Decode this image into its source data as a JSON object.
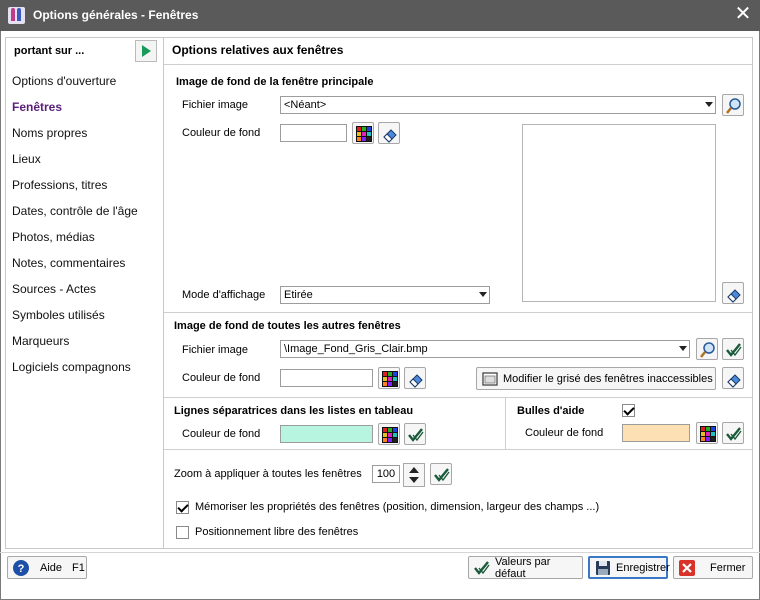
{
  "window": {
    "title": "Options générales - Fenêtres"
  },
  "nav": {
    "header": "portant sur ...",
    "items": [
      {
        "label": "Options d'ouverture",
        "active": false
      },
      {
        "label": "Fenêtres",
        "active": true
      },
      {
        "label": "Noms propres",
        "active": false
      },
      {
        "label": "Lieux",
        "active": false
      },
      {
        "label": "Professions, titres",
        "active": false
      },
      {
        "label": "Dates, contrôle de l'âge",
        "active": false
      },
      {
        "label": "Photos, médias",
        "active": false
      },
      {
        "label": "Notes, commentaires",
        "active": false
      },
      {
        "label": "Sources - Actes",
        "active": false
      },
      {
        "label": "Symboles utilisés",
        "active": false
      },
      {
        "label": "Marqueurs",
        "active": false
      },
      {
        "label": "Logiciels compagnons",
        "active": false
      }
    ]
  },
  "panel": {
    "title": "Options relatives aux fenêtres"
  },
  "main_bg": {
    "title": "Image de fond de la fenêtre principale",
    "file_label": "Fichier image",
    "file_value": "<Néant>",
    "color_label": "Couleur de fond",
    "color_value": "#ffffff",
    "mode_label": "Mode d'affichage",
    "mode_value": "Etirée"
  },
  "other_bg": {
    "title": "Image de fond de toutes les autres fenêtres",
    "file_label": "Fichier image",
    "file_value": "\\Image_Fond_Gris_Clair.bmp",
    "color_label": "Couleur de fond",
    "color_value": "#ffffff",
    "grey_button": "Modifier le grisé des fenêtres inaccessibles"
  },
  "separators": {
    "title": "Lignes séparatrices dans les listes en tableau",
    "color_label": "Couleur de fond",
    "color_value": "#b8f5e0"
  },
  "tooltips": {
    "title": "Bulles d'aide",
    "checked": true,
    "color_label": "Couleur de fond",
    "color_value": "#fde0b4"
  },
  "zoom": {
    "label": "Zoom à appliquer à toutes les fenêtres",
    "value": "100"
  },
  "options": {
    "remember_label": "Mémoriser les propriétés des fenêtres (position, dimension, largeur des champs ...)",
    "remember_checked": true,
    "free_label": "Positionnement libre des fenêtres",
    "free_checked": false
  },
  "footer": {
    "help_label": "Aide",
    "help_key": "F1",
    "defaults_label": "Valeurs par défaut",
    "save_label": "Enregistrer",
    "close_label": "Fermer"
  },
  "colors": {
    "titlebar": "#5a5a5a",
    "active_nav": "#5a1f7a",
    "focus_border": "#3a78c8"
  },
  "icons": [
    "app-icon",
    "close-icon",
    "play-icon",
    "search-icon",
    "palette-icon",
    "eraser-icon",
    "validate-icon",
    "help-icon",
    "save-icon",
    "cancel-icon",
    "window-icon"
  ]
}
